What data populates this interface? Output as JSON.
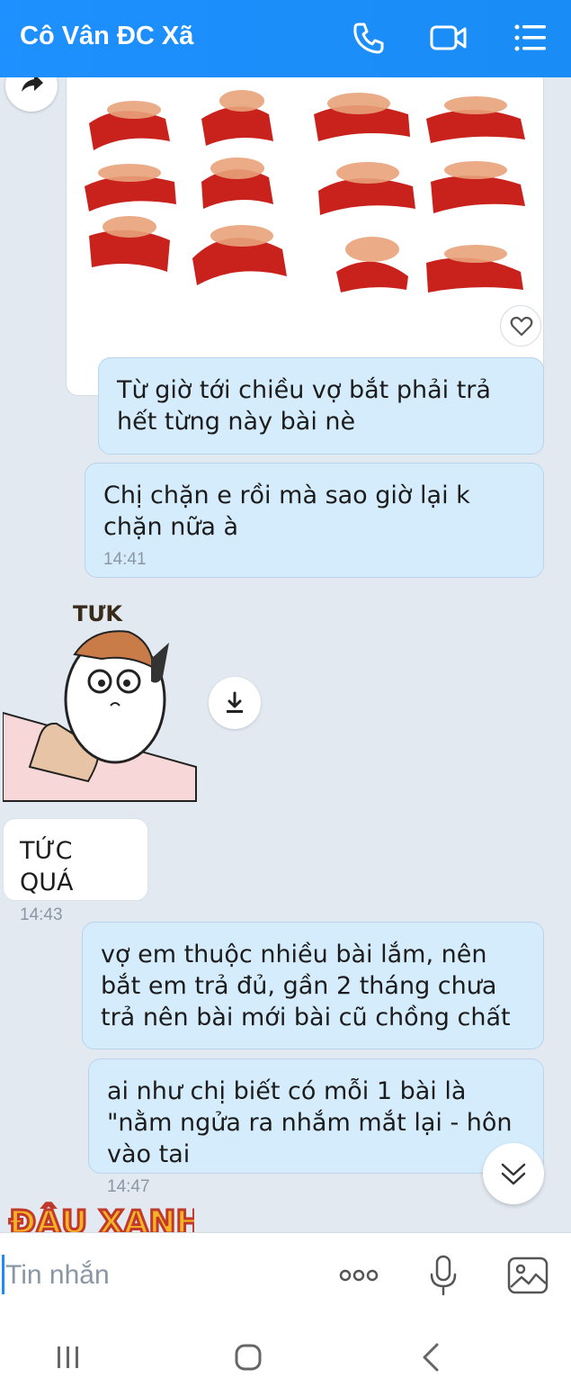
{
  "header": {
    "title": "Cô Vân ĐC Xã"
  },
  "messages": [
    {
      "text": "Từ giờ tới chiều vợ bắt phải trả hết từng này bài nè"
    },
    {
      "text": "Chị chặn e rồi mà sao giờ lại k chặn nữa à",
      "time": "14:41"
    },
    {
      "sticker_text": "TỨK"
    },
    {
      "text": "TỨC QUÁ",
      "time": "14:43"
    },
    {
      "text": "vợ em thuộc nhiều bài lắm, nên bắt em trả đủ, gần 2 tháng chưa trả nên bài mới bài cũ chồng chất"
    },
    {
      "text": "ai như chị biết có mỗi 1 bài là \"nằm ngửa ra nhắm mắt lại - hôn vào tai",
      "time": "14:47"
    },
    {
      "sticker_text": "ĐẬU XANH"
    }
  ],
  "input": {
    "placeholder": "Tin nhắn"
  },
  "icons": {
    "header": [
      "phone-icon",
      "video-call-icon",
      "menu-list-icon"
    ],
    "input": [
      "more-icon",
      "microphone-icon",
      "image-icon"
    ],
    "nav": [
      "recent-apps-icon",
      "home-icon",
      "back-icon"
    ]
  },
  "colors": {
    "header": "#1a8cf5",
    "outgoing_bubble": "#d5ecfd",
    "chat_bg": "#e2e9f1"
  }
}
